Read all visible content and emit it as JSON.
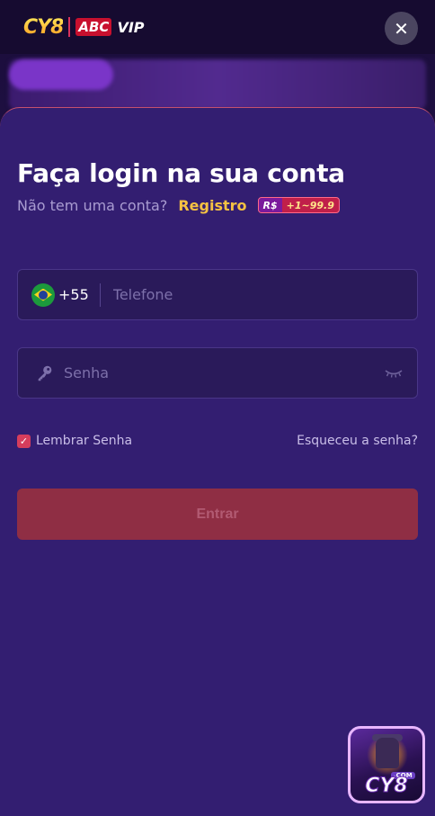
{
  "background": {
    "logo": {
      "brand": "CY8",
      "partner_badge": "ABC",
      "partner_suffix": "VIP"
    }
  },
  "close_label": "✕",
  "login": {
    "title": "Faça login na sua conta",
    "no_account_text": "Não tem uma conta?",
    "register_label": "Registro",
    "bonus_currency": "R$",
    "bonus_amount": "+1~99.9",
    "phone": {
      "country_code": "+55",
      "flag": "brazil-flag",
      "placeholder": "Telefone",
      "value": ""
    },
    "password": {
      "placeholder": "Senha",
      "value": ""
    },
    "remember_label": "Lembrar Senha",
    "remember_checked": true,
    "forgot_label": "Esqueceu a senha?",
    "submit_label": "Entrar"
  },
  "app_badge": {
    "com_label": ".COM",
    "brand": "CY8"
  },
  "colors": {
    "sheet_bg": "#331e71",
    "accent_yellow": "#f6c242",
    "submit_bg": "#8f2e44",
    "checkbox": "#d63d5c"
  }
}
